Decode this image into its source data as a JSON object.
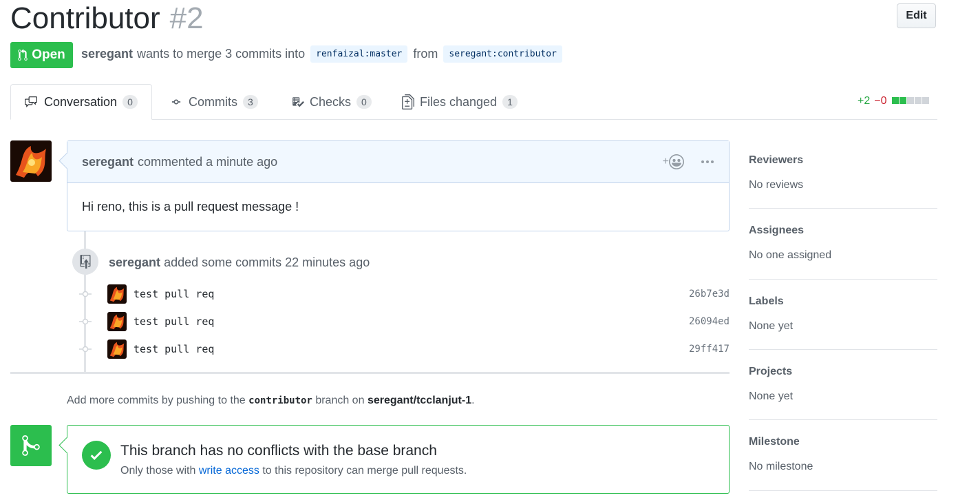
{
  "header": {
    "title": "Contributor",
    "number": "#2",
    "edit_label": "Edit",
    "state_label": "Open",
    "author": "seregant",
    "merge_text": "wants to merge 3 commits into",
    "base_branch": "renfaizal:master",
    "from_text": "from",
    "head_branch": "seregant:contributor"
  },
  "tabs": [
    {
      "label": "Conversation",
      "count": "0"
    },
    {
      "label": "Commits",
      "count": "3"
    },
    {
      "label": "Checks",
      "count": "0"
    },
    {
      "label": "Files changed",
      "count": "1"
    }
  ],
  "diffstat": {
    "additions": "+2",
    "deletions": "−0"
  },
  "comment": {
    "author": "seregant",
    "action": "commented a minute ago",
    "body": "Hi reno, this is a pull request message !"
  },
  "push_event": {
    "author": "seregant",
    "text": "added some commits 22 minutes ago"
  },
  "commits": [
    {
      "message": "test pull req",
      "sha": "26b7e3d"
    },
    {
      "message": "test pull req",
      "sha": "26094ed"
    },
    {
      "message": "test pull req",
      "sha": "29ff417"
    }
  ],
  "hint": {
    "prefix": "Add more commits by pushing to the",
    "branch": "contributor",
    "middle": "branch on",
    "repo": "seregant/tcclanjut-1",
    "suffix": "."
  },
  "merge": {
    "title": "This branch has no conflicts with the base branch",
    "sub_prefix": "Only those with",
    "sub_link": "write access",
    "sub_suffix": "to this repository can merge pull requests."
  },
  "sidebar": [
    {
      "title": "Reviewers",
      "value": "No reviews"
    },
    {
      "title": "Assignees",
      "value": "No one assigned"
    },
    {
      "title": "Labels",
      "value": "None yet"
    },
    {
      "title": "Projects",
      "value": "None yet"
    },
    {
      "title": "Milestone",
      "value": "No milestone"
    }
  ],
  "colors": {
    "open_green": "#2cbe4e",
    "link_blue": "#0366d6",
    "deletion_red": "#cb2431"
  }
}
